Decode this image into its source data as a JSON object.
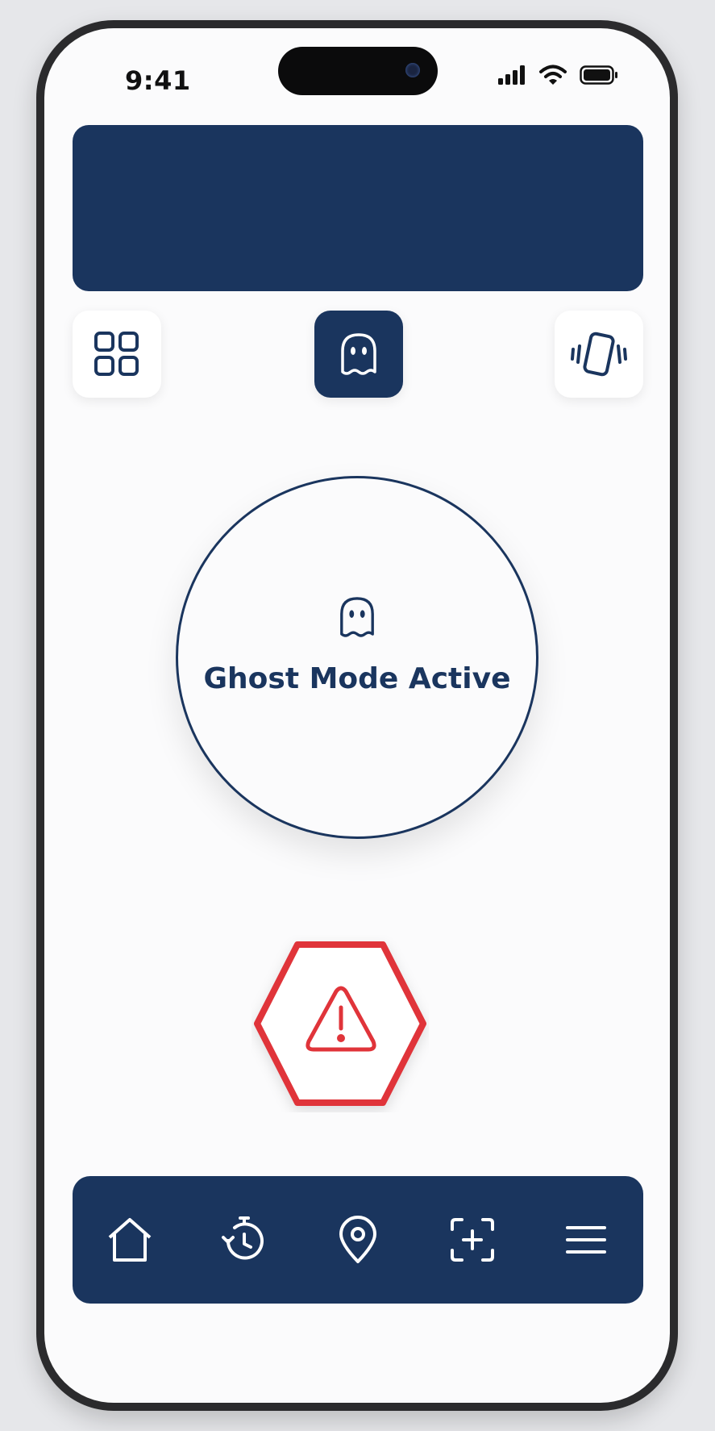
{
  "status_bar": {
    "time": "9:41"
  },
  "colors": {
    "primary": "#1a355e",
    "alert": "#e0343a",
    "background": "#fbfbfc"
  },
  "toolbar": {
    "left_icon": "grid-icon",
    "center_icon": "ghost-icon",
    "right_icon": "vibrate-icon"
  },
  "status_card": {
    "icon": "ghost-icon",
    "label": "Ghost Mode Active"
  },
  "sos": {
    "icon": "warning-icon"
  },
  "bottom_nav": {
    "items": [
      "home-icon",
      "history-icon",
      "location-pin-icon",
      "add-scan-icon",
      "menu-icon"
    ]
  }
}
